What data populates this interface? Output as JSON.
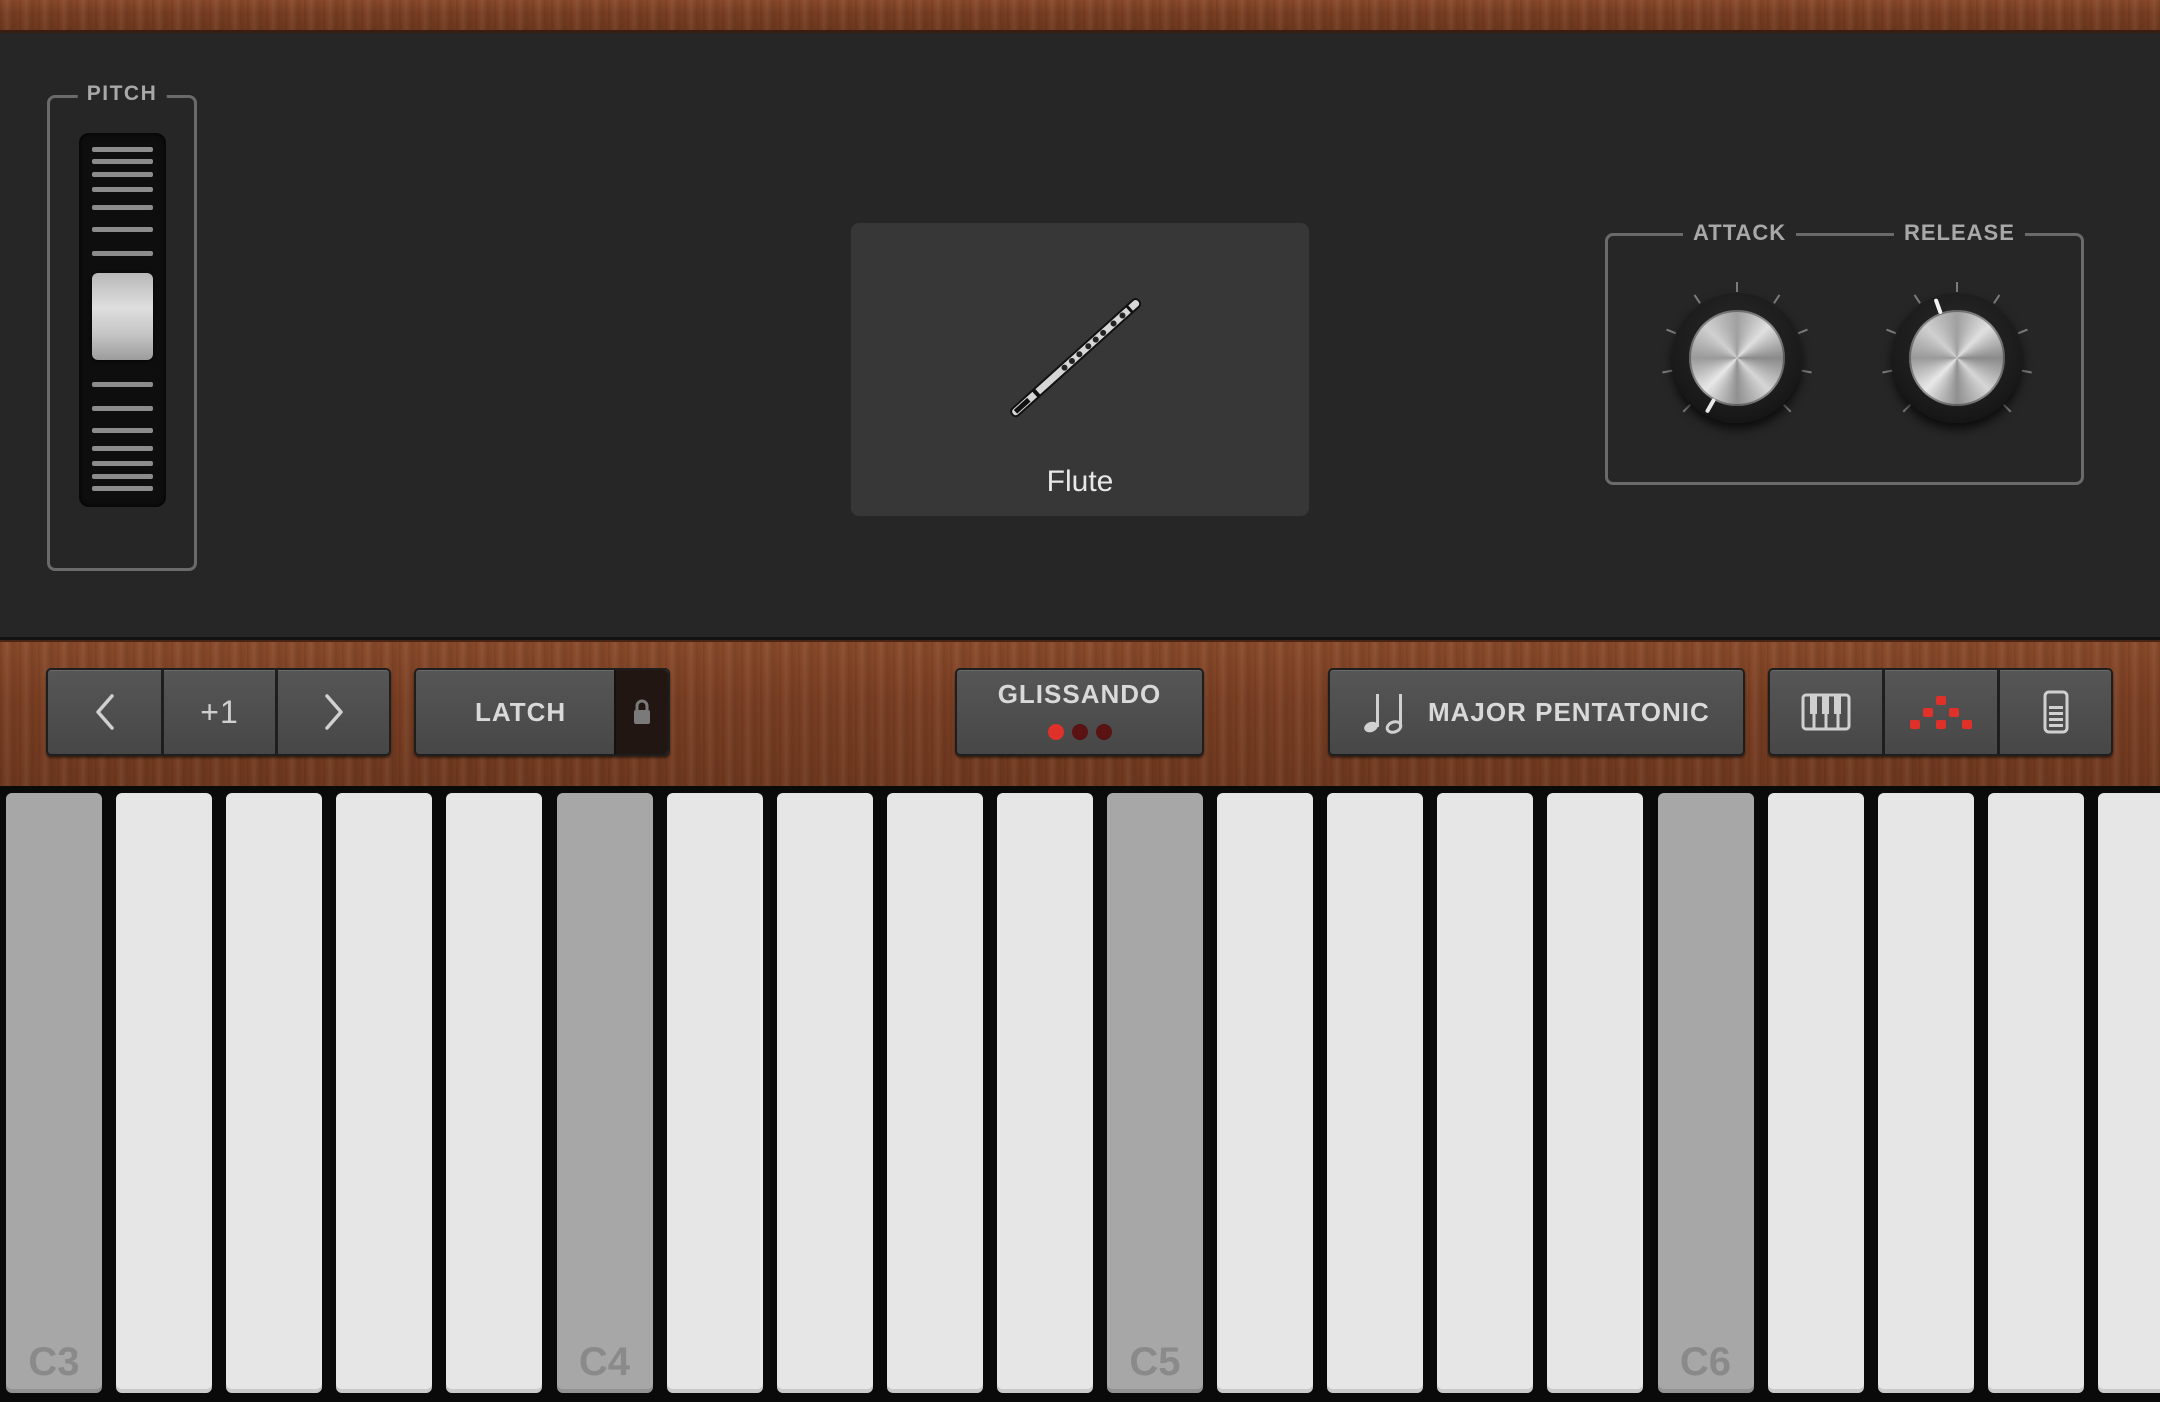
{
  "pitch": {
    "label": "PITCH"
  },
  "instrument": {
    "name": "Flute",
    "icon": "flute-icon"
  },
  "envelope": {
    "attack_label": "ATTACK",
    "release_label": "RELEASE"
  },
  "controls": {
    "octave_value": "+1",
    "prev_icon": "chevron-left-icon",
    "next_icon": "chevron-right-icon",
    "latch_label": "LATCH",
    "lock_icon": "lock-icon",
    "glissando_label": "GLISSANDO",
    "glissando_dots": [
      "#e0302a",
      "#5a1212",
      "#5a1212"
    ],
    "scale_icon": "music-notes-icon",
    "scale_label": "MAJOR PENTATONIC",
    "view_icons": [
      "keyboard-icon",
      "arpeggio-dots-icon",
      "strip-icon"
    ],
    "accent_color": "#e0302a"
  },
  "keyboard": {
    "keys": [
      {
        "label": "C3",
        "c": true
      },
      {
        "label": "",
        "c": false
      },
      {
        "label": "",
        "c": false
      },
      {
        "label": "",
        "c": false
      },
      {
        "label": "",
        "c": false
      },
      {
        "label": "C4",
        "c": true
      },
      {
        "label": "",
        "c": false
      },
      {
        "label": "",
        "c": false
      },
      {
        "label": "",
        "c": false
      },
      {
        "label": "",
        "c": false
      },
      {
        "label": "C5",
        "c": true
      },
      {
        "label": "",
        "c": false
      },
      {
        "label": "",
        "c": false
      },
      {
        "label": "",
        "c": false
      },
      {
        "label": "",
        "c": false
      },
      {
        "label": "C6",
        "c": true
      },
      {
        "label": "",
        "c": false
      },
      {
        "label": "",
        "c": false
      },
      {
        "label": "",
        "c": false
      },
      {
        "label": "",
        "c": false
      }
    ]
  }
}
